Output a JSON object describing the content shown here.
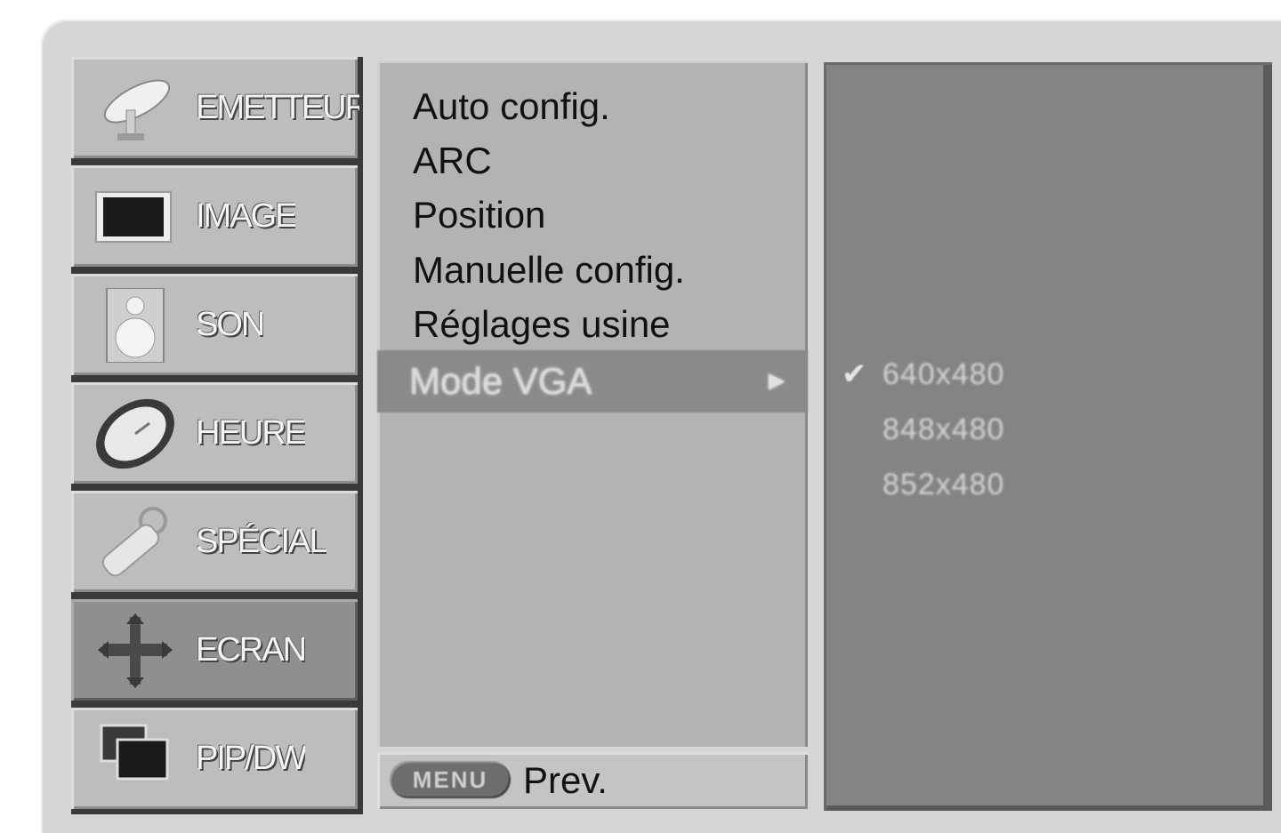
{
  "sidebar": {
    "items": [
      {
        "label": "EMETTEUR",
        "icon": "satellite-dish-icon"
      },
      {
        "label": "IMAGE",
        "icon": "picture-icon"
      },
      {
        "label": "SON",
        "icon": "speaker-icon"
      },
      {
        "label": "HEURE",
        "icon": "clock-icon"
      },
      {
        "label": "SPÉCIAL",
        "icon": "remote-control-icon"
      },
      {
        "label": "ECRAN",
        "icon": "move-arrows-icon"
      },
      {
        "label": "PIP/DW",
        "icon": "pip-windows-icon"
      }
    ],
    "active_index": 5
  },
  "menu": {
    "items": [
      {
        "label": "Auto config."
      },
      {
        "label": "ARC"
      },
      {
        "label": "Position"
      },
      {
        "label": "Manuelle config."
      },
      {
        "label": "Réglages usine"
      },
      {
        "label": "Mode VGA"
      }
    ],
    "selected_index": 5,
    "submenu_arrow": "►"
  },
  "submenu": {
    "options": [
      "640x480",
      "848x480",
      "852x480"
    ],
    "checked_index": 0,
    "check_mark": "✔"
  },
  "footer": {
    "key_label": "MENU",
    "action_label": "Prev."
  },
  "colors": {
    "frame": "#d6d6d6",
    "item_bg": "#bdbdbd",
    "active_bg": "#8f8f8f",
    "panel_bg": "#b3b3b3",
    "sub_panel_bg": "#848484"
  }
}
